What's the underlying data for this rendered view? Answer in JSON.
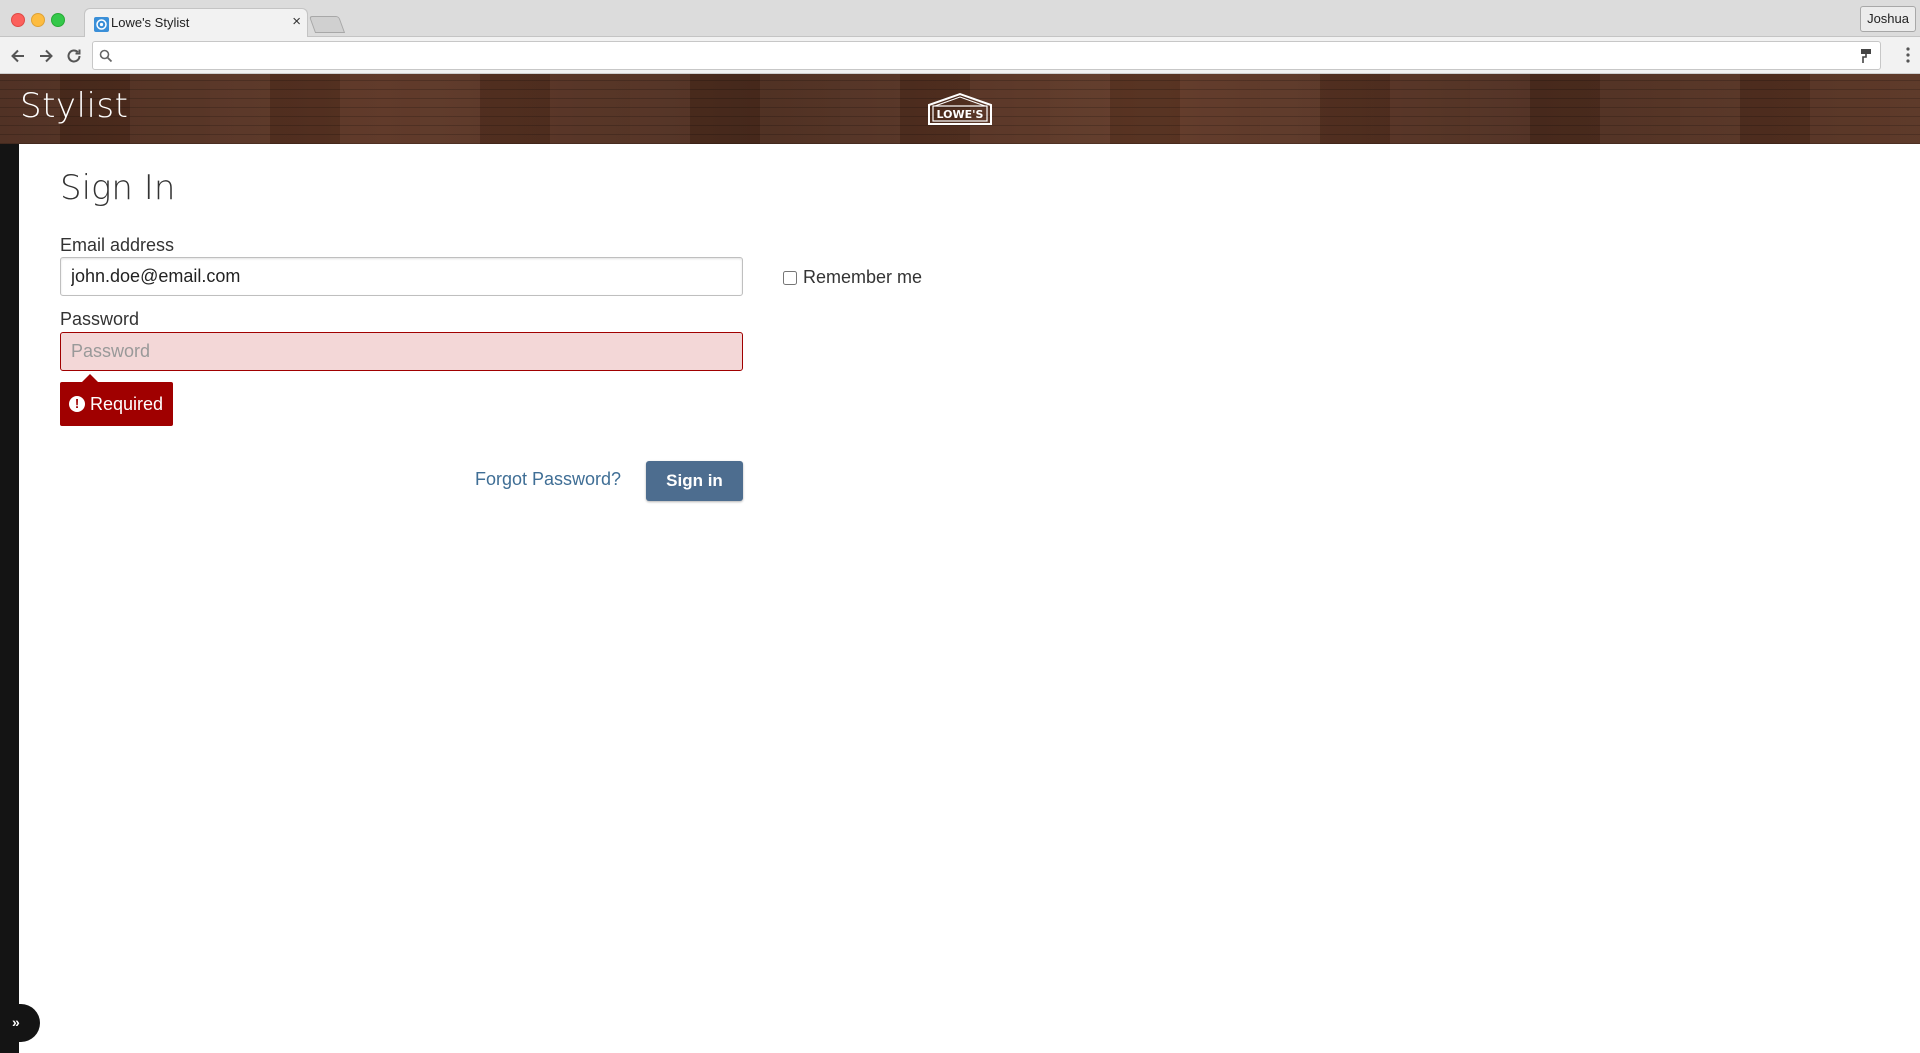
{
  "browser": {
    "tab_title": "Lowe's Stylist",
    "tab_close": "×",
    "profile_name": "Joshua",
    "address_value": ""
  },
  "header": {
    "app_title": "Stylist",
    "brand_logo_text": "LOWE'S"
  },
  "form": {
    "title": "Sign In",
    "email_label": "Email address",
    "email_value": "john.doe@email.com",
    "password_label": "Password",
    "password_placeholder": "Password",
    "password_error": "Required",
    "error_icon": "!",
    "remember_label": "Remember me",
    "remember_checked": false,
    "forgot_link": "Forgot Password?",
    "signin_button": "Sign in"
  },
  "colors": {
    "header_wood": "#4a2a1c",
    "error_red": "#a00000",
    "error_field_bg": "#f3d7d7",
    "primary_button": "#4d6d8f",
    "link": "#3f6e95",
    "side_rail": "#141414"
  }
}
